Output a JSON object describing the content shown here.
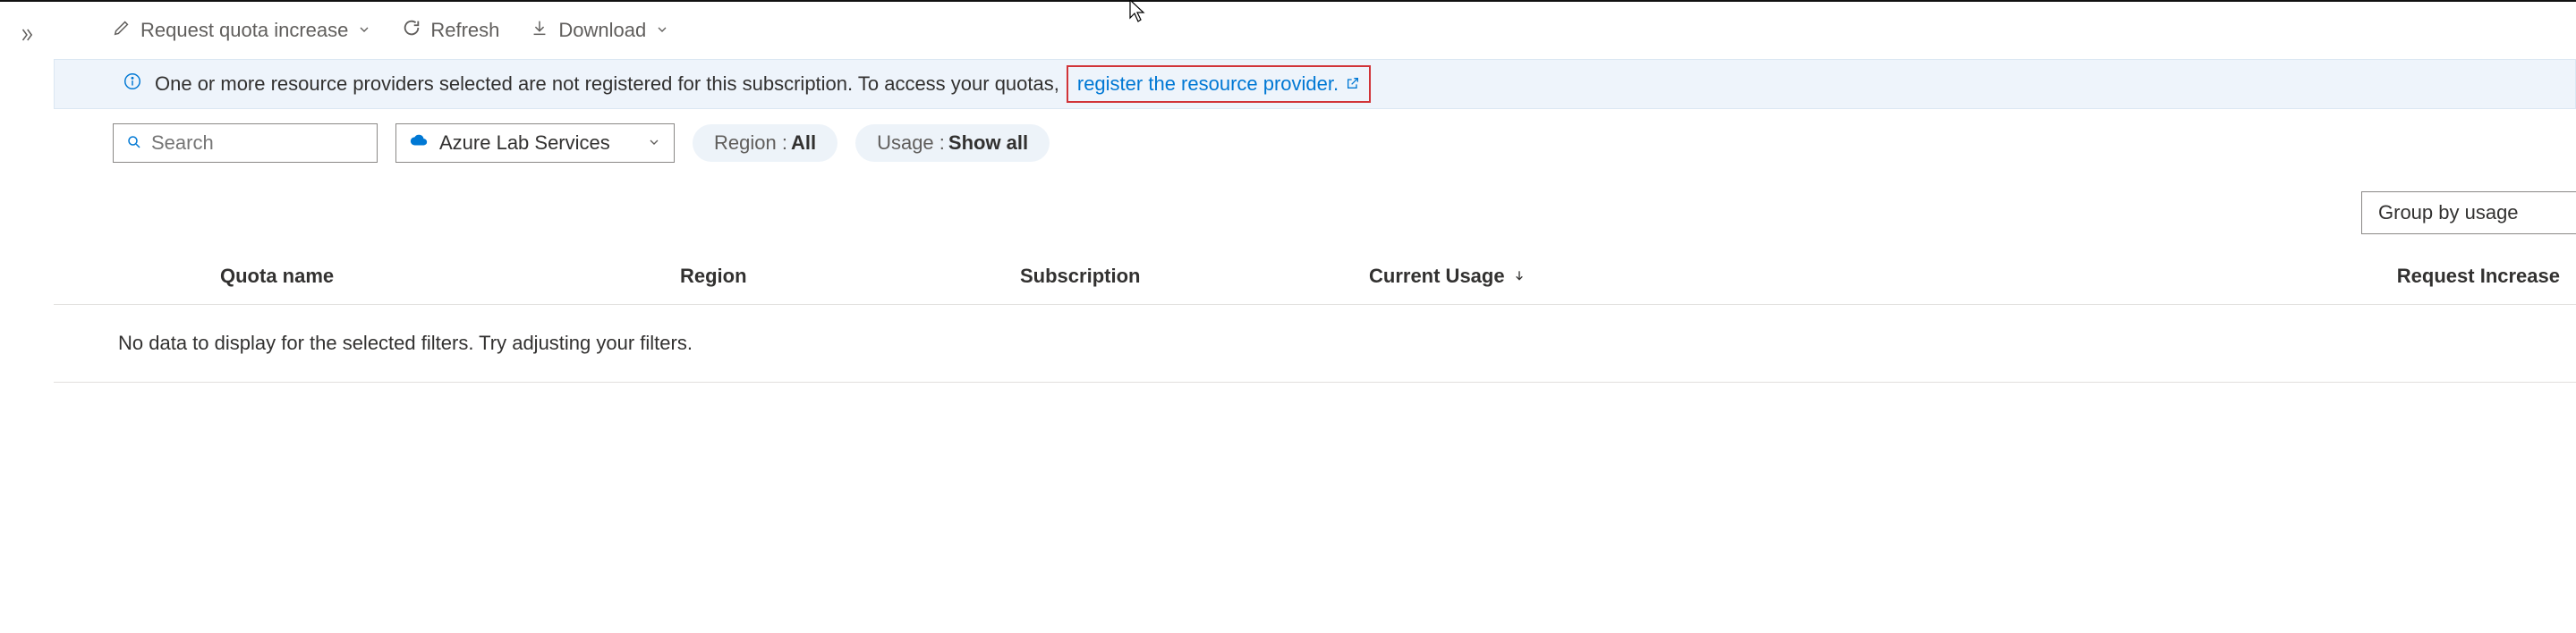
{
  "toolbar": {
    "request_increase_label": "Request quota increase",
    "refresh_label": "Refresh",
    "download_label": "Download"
  },
  "banner": {
    "message": "One or more resource providers selected are not registered for this subscription. To access your quotas,",
    "link_text": "register the resource provider."
  },
  "filters": {
    "search_placeholder": "Search",
    "provider_label": "Azure Lab Services",
    "region_label": "Region :",
    "region_value": "All",
    "usage_label": "Usage :",
    "usage_value": "Show all"
  },
  "groupby": {
    "label": "Group by usage"
  },
  "table": {
    "columns": {
      "quota": "Quota name",
      "region": "Region",
      "subscription": "Subscription",
      "usage": "Current Usage",
      "request": "Request Increase"
    },
    "empty_message": "No data to display for the selected filters. Try adjusting your filters."
  }
}
